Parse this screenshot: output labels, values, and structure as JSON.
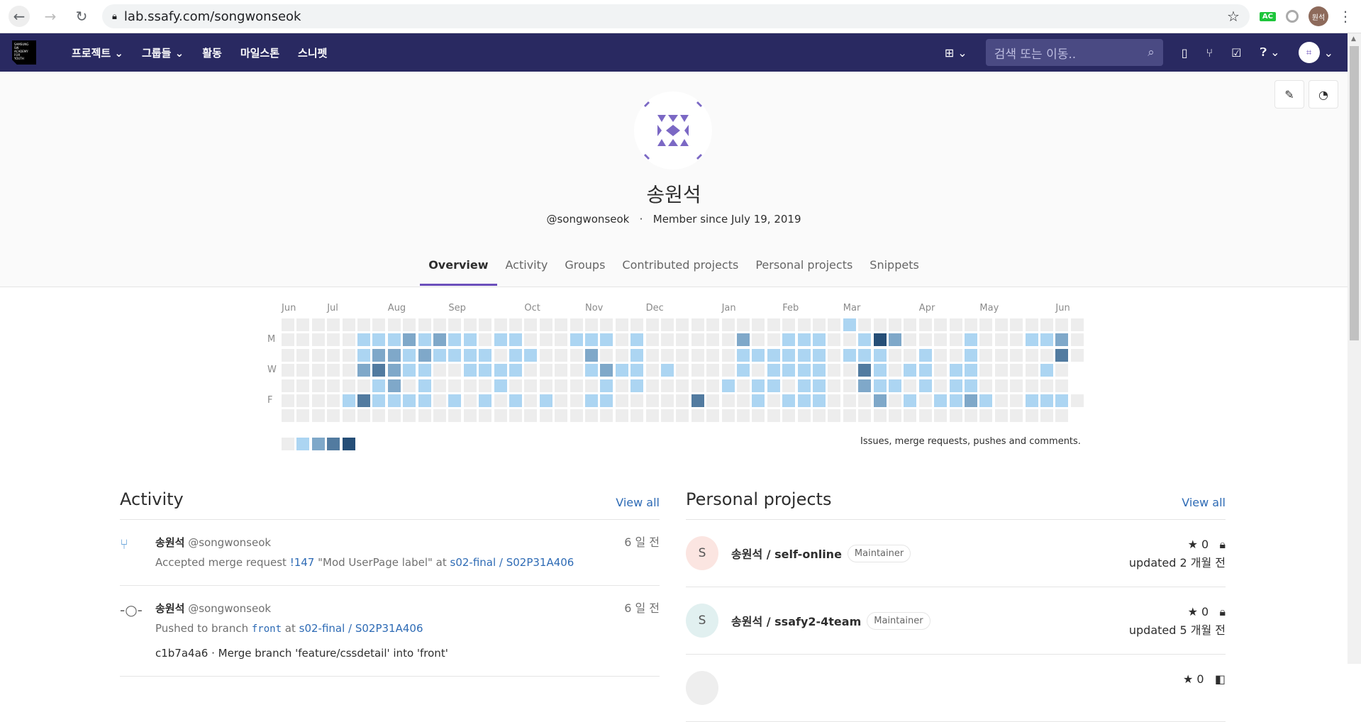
{
  "browser": {
    "url": "lab.ssafy.com/songwonseok",
    "ext_label": "AC",
    "profile_label": "원석"
  },
  "nav": {
    "logo_text": "SAMSUNG SW ACADEMY FOR YOUTH",
    "links": [
      {
        "label": "프로젝트 ⌄"
      },
      {
        "label": "그룹들 ⌄"
      },
      {
        "label": "활동"
      },
      {
        "label": "마일스톤"
      },
      {
        "label": "스니펫"
      }
    ],
    "search_placeholder": "검색 또는 이동.."
  },
  "profile": {
    "name": "송원석",
    "handle": "@songwonseok",
    "separator": "·",
    "member_since": "Member since July 19, 2019"
  },
  "tabs": [
    {
      "label": "Overview",
      "active": true
    },
    {
      "label": "Activity"
    },
    {
      "label": "Groups"
    },
    {
      "label": "Contributed projects"
    },
    {
      "label": "Personal projects"
    },
    {
      "label": "Snippets"
    }
  ],
  "chart_data": {
    "type": "heatmap",
    "months": [
      {
        "label": "Jun",
        "week": 0
      },
      {
        "label": "Jul",
        "week": 3
      },
      {
        "label": "Aug",
        "week": 7
      },
      {
        "label": "Sep",
        "week": 11
      },
      {
        "label": "Oct",
        "week": 16
      },
      {
        "label": "Nov",
        "week": 20
      },
      {
        "label": "Dec",
        "week": 24
      },
      {
        "label": "Jan",
        "week": 29
      },
      {
        "label": "Feb",
        "week": 33
      },
      {
        "label": "Mar",
        "week": 37
      },
      {
        "label": "Apr",
        "week": 42
      },
      {
        "label": "May",
        "week": 46
      },
      {
        "label": "Jun",
        "week": 51
      }
    ],
    "day_labels": [
      {
        "label": "M",
        "row": 1
      },
      {
        "label": "W",
        "row": 3
      },
      {
        "label": "F",
        "row": 5
      }
    ],
    "levels_by_day": [
      "00000000000000000000000000000000000001000000000000000",
      "00000111212110110001110100000020011100142000010001120",
      "00000122121111011000200100000011111101110010010000030",
      "0000023211001111000012110100001011110031011011000010",
      "0000001201000010000001010000010110110021101011000000",
      "0000131111010101010011000003000101110002010112100111 0",
      "0000000000000000000000000000000000000000000000000000"
    ],
    "level_colors": [
      "#ededed",
      "#acd5f2",
      "#7fa8c9",
      "#527ba0",
      "#254e77"
    ],
    "note": "Issues, merge requests, pushes and comments."
  },
  "activity": {
    "title": "Activity",
    "view_all": "View all",
    "items": [
      {
        "icon": "merge-request-icon",
        "name": "송원석",
        "handle": "@songwonseok",
        "time": "6 일 전",
        "pre": "Accepted merge request ",
        "ref": "!147",
        "mid": " \"Mod UserPage label\" at ",
        "project": "s02-final / S02P31A406"
      },
      {
        "icon": "commit-icon",
        "name": "송원석",
        "handle": "@songwonseok",
        "time": "6 일 전",
        "pre": "Pushed to branch ",
        "ref": "front",
        "mid": " at ",
        "project": "s02-final / S02P31A406",
        "commit": "c1b7a4a6 · Merge branch 'feature/cssdetail' into 'front'"
      }
    ]
  },
  "projects": {
    "title": "Personal projects",
    "view_all": "View all",
    "items": [
      {
        "initial": "S",
        "name": "송원석 / self-online",
        "role": "Maintainer",
        "stars": "0",
        "updated": "updated 2 개월 전",
        "avatar_color": "#fbe5e1"
      },
      {
        "initial": "S",
        "name": "송원석 / ssafy2-4team",
        "role": "Maintainer",
        "stars": "0",
        "updated": "updated 5 개월 전",
        "avatar_color": "#e1f0f0"
      },
      {
        "initial": "",
        "name": "",
        "role": "",
        "stars": "0",
        "updated": "",
        "avatar_color": "#eeeeee"
      }
    ]
  },
  "colors": {
    "nav": "#292961",
    "accent": "#6b4fbb",
    "link": "#2e6bb5"
  }
}
